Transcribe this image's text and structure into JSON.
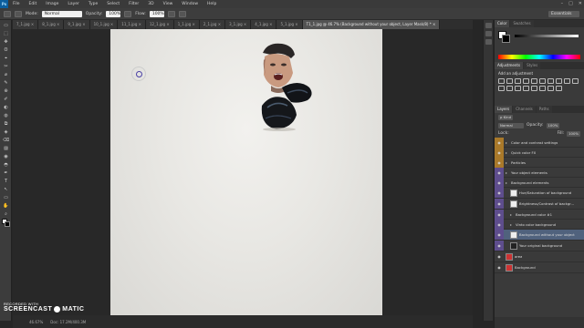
{
  "app": {
    "logo": "Ps"
  },
  "menu": [
    "File",
    "Edit",
    "Image",
    "Layer",
    "Type",
    "Select",
    "Filter",
    "3D",
    "View",
    "Window",
    "Help"
  ],
  "window_controls": [
    "–",
    "□",
    "✕"
  ],
  "options": {
    "mode_label": "Mode:",
    "mode_value": "Normal",
    "opacity_label": "Opacity:",
    "opacity_value": "100%",
    "flow_label": "Flow:",
    "flow_value": "100%",
    "workspace": "Essentials"
  },
  "tabs": [
    {
      "label": "7_1.jpg ×",
      "active": false
    },
    {
      "label": "8_1.jpg ×",
      "active": false
    },
    {
      "label": "9_1.jpg ×",
      "active": false
    },
    {
      "label": "10_1.jpg ×",
      "active": false
    },
    {
      "label": "11_1.jpg ×",
      "active": false
    },
    {
      "label": "12_1.jpg ×",
      "active": false
    },
    {
      "label": "1_1.jpg ×",
      "active": false
    },
    {
      "label": "2_1.jpg ×",
      "active": false
    },
    {
      "label": "3_1.jpg ×",
      "active": false
    },
    {
      "label": "4_1.jpg ×",
      "active": false
    },
    {
      "label": "5_1.jpg ×",
      "active": false
    },
    {
      "label": "T1_1.jpg @ 46.7% (Background without your object, Layer Mask/8) * ×",
      "active": true
    }
  ],
  "tools": [
    "▭",
    "⬚",
    "✥",
    "ʘ",
    "⌖",
    "✂",
    "⌀",
    "✎",
    "⊕",
    "✐",
    "◐",
    "◍",
    "⧉",
    "◈",
    "⌫",
    "▨",
    "◉",
    "◓",
    "✒",
    "T",
    "↖",
    "▭",
    "✋",
    "⌕"
  ],
  "status": {
    "zoom": "46.67%",
    "doc": "Doc: 17.2M/400.3M"
  },
  "watermark": {
    "line1": "RECORDED WITH",
    "line2a": "SCREENCAST",
    "line2b": "MATIC"
  },
  "color_panel": {
    "tabs": [
      "Color",
      "Swatches"
    ]
  },
  "adjustments": {
    "tabs": [
      "Adjustments",
      "Styles"
    ],
    "title": "Add an adjustment"
  },
  "layers_panel": {
    "tabs": [
      "Layers",
      "Channels",
      "Paths"
    ],
    "kind_label": "ρ Kind",
    "blend_mode": "Normal",
    "opacity_label": "Opacity:",
    "opacity_value": "100%",
    "lock_label": "Lock:",
    "fill_label": "Fill:",
    "fill_value": "100%",
    "rows": [
      {
        "name": "Color and contrast settings",
        "eye": "orange",
        "folder": true,
        "indent": 0
      },
      {
        "name": "Quick color FX",
        "eye": "orange",
        "folder": true,
        "indent": 0
      },
      {
        "name": "Particles",
        "eye": "orange",
        "folder": true,
        "indent": 0
      },
      {
        "name": "Your object elements",
        "eye": "purple",
        "folder": true,
        "indent": 0
      },
      {
        "name": "Background elements",
        "eye": "purple",
        "folder": true,
        "indent": 0
      },
      {
        "name": "Hue/Saturation of background",
        "eye": "purple",
        "thumb": "light",
        "indent": 1,
        "tall": true
      },
      {
        "name": "Brightness/Contrast of backgr...",
        "eye": "purple",
        "thumb": "light",
        "indent": 1,
        "tall": true
      },
      {
        "name": "Background color #1",
        "eye": "purple",
        "folder": true,
        "indent": 1
      },
      {
        "name": "Vinto color background",
        "eye": "purple",
        "folder": true,
        "indent": 1
      },
      {
        "name": "Background without your object",
        "eye": "purple",
        "thumb": "light",
        "indent": 1,
        "selected": true,
        "tall": true
      },
      {
        "name": "Your original background",
        "eye": "purple",
        "thumb": "dark",
        "indent": 1,
        "tall": true
      },
      {
        "name": "area",
        "eye": "none",
        "thumb": "red",
        "indent": 0,
        "tall": true
      },
      {
        "name": "Background",
        "eye": "none",
        "thumb": "red",
        "indent": 0,
        "tall": true
      }
    ]
  }
}
